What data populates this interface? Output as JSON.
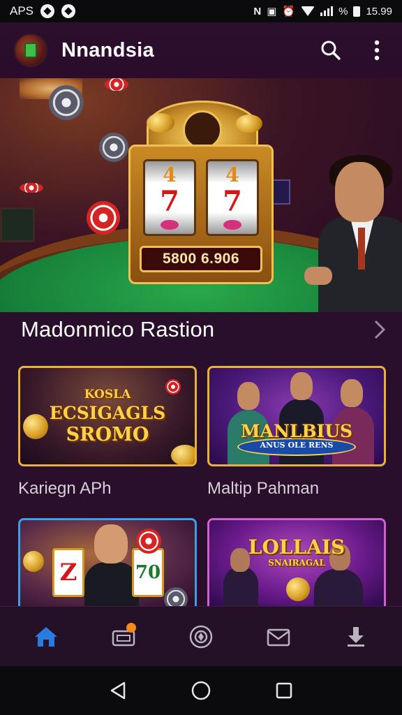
{
  "status_bar": {
    "carrier": "APS",
    "battery_text": "%",
    "time": "15.99"
  },
  "app_bar": {
    "title": "Nnandsia",
    "icons": [
      "avatar",
      "search-icon",
      "more-vert-icon"
    ]
  },
  "hero": {
    "slot_counter": "5800 6.906",
    "reel_symbols": [
      [
        "4",
        "7"
      ],
      [
        "4",
        "7"
      ]
    ]
  },
  "section": {
    "title": "Madonmico Rastion"
  },
  "cards": [
    {
      "label": "Kariegn APh",
      "art_line1": "KOSLA",
      "art_line2": "ECSIGAGLS",
      "art_line3": "SROMO"
    },
    {
      "label": "Maltip Pahman",
      "art_line1": "MANLBIUS",
      "art_line2": "ANUS OLE RENS"
    },
    {
      "label": "",
      "art_reel1": "Z",
      "art_reel2": "70"
    },
    {
      "label": "",
      "art_line1": "LOLLAIS",
      "art_line2": "SNAIRAGAL"
    }
  ],
  "bottom_nav": {
    "items": [
      "home-icon",
      "wallet-icon",
      "casino-chip-icon",
      "mail-icon",
      "download-icon"
    ],
    "active": "home-icon",
    "badge_on": "wallet-icon"
  },
  "colors": {
    "background": "#2a0f2c",
    "accent_blue": "#2a7be0",
    "gold": "#e8b23a",
    "badge": "#f58a1a"
  }
}
